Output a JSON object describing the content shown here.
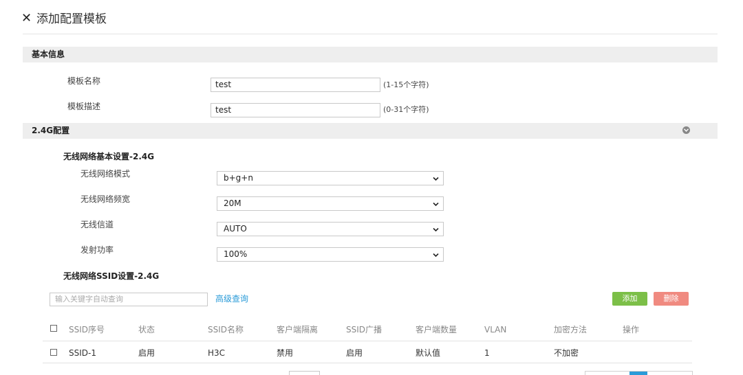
{
  "dialog": {
    "title": "添加配置模板",
    "close_icon": "close-icon"
  },
  "basic": {
    "section_title": "基本信息",
    "name_label": "模板名称",
    "name_value": "test",
    "name_hint": "(1-15个字符)",
    "desc_label": "模板描述",
    "desc_value": "test",
    "desc_hint": "(0-31个字符)"
  },
  "band24": {
    "section_title": "2.4G配置",
    "collapse_icon": "collapse-chevron-icon",
    "basic_settings_title": "无线网络基本设置-2.4G",
    "fields": [
      {
        "label": "无线网络模式",
        "value": "b+g+n"
      },
      {
        "label": "无线网络频宽",
        "value": "20M"
      },
      {
        "label": "无线信道",
        "value": "AUTO"
      },
      {
        "label": "发射功率",
        "value": "100%"
      }
    ],
    "ssid_title": "无线网络SSID设置-2.4G",
    "search_placeholder": "输入关键字自动查询",
    "advanced_search": "高级查询",
    "add_button": "添加",
    "delete_button": "删除",
    "table": {
      "headers": [
        "SSID序号",
        "状态",
        "SSID名称",
        "客户端隔离",
        "SSID广播",
        "客户端数量",
        "VLAN",
        "加密方法",
        "操作"
      ],
      "rows": [
        [
          "SSID-1",
          "启用",
          "H3C",
          "禁用",
          "启用",
          "默认值",
          "1",
          "不加密",
          ""
        ]
      ]
    }
  },
  "colors": {
    "add_button": "#7cbf48",
    "delete_button": "#f08a80",
    "link": "#2a9bd8",
    "section_bar": "#eeeeee"
  }
}
